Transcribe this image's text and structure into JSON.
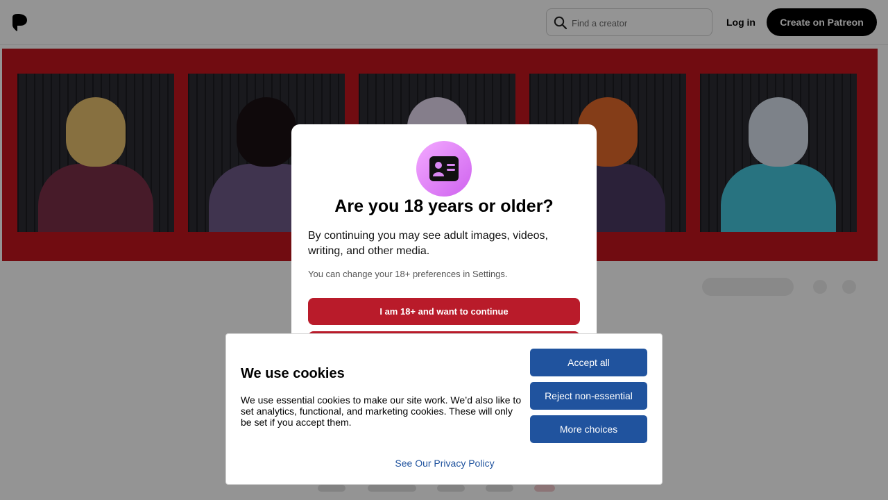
{
  "header": {
    "search_placeholder": "Find a creator",
    "login_label": "Log in",
    "create_label": "Create on Patreon"
  },
  "hero": {
    "background_color": "#c3151e",
    "panels": [
      {
        "name": "hero-panel-1",
        "head": "#e8c26f",
        "body": "#7a2f48"
      },
      {
        "name": "hero-panel-2",
        "head": "#1a1014",
        "body": "#6e5a89"
      },
      {
        "name": "hero-panel-3",
        "head": "#e5d9f0",
        "body": "#b54b7a"
      },
      {
        "name": "hero-panel-4",
        "head": "#e36a2a",
        "body": "#4a3a62"
      },
      {
        "name": "hero-panel-5",
        "head": "#d8e0ec",
        "body": "#46c7dd"
      }
    ]
  },
  "age_gate": {
    "title": "Are you 18 years or older?",
    "description": "By continuing you may see adult images, videos, writing, and other media.",
    "note": "You can change your 18+ preferences in Settings.",
    "continue_label": "I am 18+ and want to continue",
    "accent_color": "#b91b2a"
  },
  "cookie_banner": {
    "title": "We use cookies",
    "body": "We use essential cookies to make our site work. We’d also like to set analytics, functional, and marketing cookies. These will only be set if you accept them.",
    "accept_label": "Accept all",
    "reject_label": "Reject non-essential",
    "more_label": "More choices",
    "policy_label": "See Our Privacy Policy",
    "button_color": "#20539e"
  }
}
